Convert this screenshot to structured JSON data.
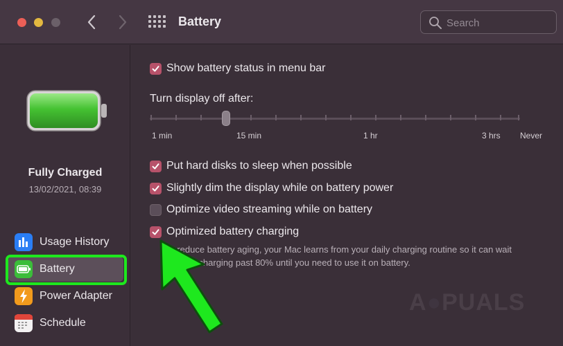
{
  "window": {
    "title": "Battery"
  },
  "search": {
    "placeholder": "Search"
  },
  "sidebar": {
    "status_title": "Fully Charged",
    "status_time": "13/02/2021, 08:39",
    "items": [
      {
        "label": "Usage History",
        "icon": "bar-chart-icon"
      },
      {
        "label": "Battery",
        "icon": "battery-icon",
        "selected": true
      },
      {
        "label": "Power Adapter",
        "icon": "power-plug-icon"
      },
      {
        "label": "Schedule",
        "icon": "calendar-icon"
      }
    ]
  },
  "main": {
    "show_status": {
      "label": "Show battery status in menu bar",
      "checked": true
    },
    "display_off": {
      "label": "Turn display off after:",
      "value": "15 min",
      "ticks": [
        "1 min",
        "15 min",
        "1 hr",
        "3 hrs",
        "Never"
      ]
    },
    "options": [
      {
        "label": "Put hard disks to sleep when possible",
        "checked": true
      },
      {
        "label": "Slightly dim the display while on battery power",
        "checked": true
      },
      {
        "label": "Optimize video streaming while on battery",
        "checked": false
      },
      {
        "label": "Optimized battery charging",
        "checked": true
      }
    ],
    "description_line1": "To reduce battery aging, your Mac learns from your daily charging routine so it can wait",
    "description_line2": "to finish charging past 80% until you need to use it on battery."
  },
  "colors": {
    "accent_checkbox": "#b7526a",
    "battery_green": "#4cd23a",
    "highlight_green": "#1ee81e"
  },
  "watermark": "A PUALS"
}
